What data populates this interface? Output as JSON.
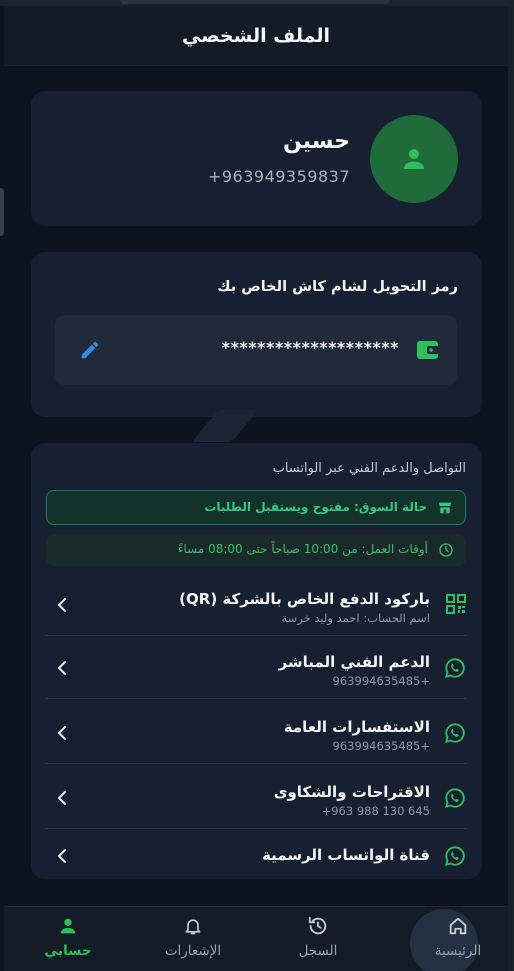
{
  "header": {
    "title": "الملف الشخصي"
  },
  "profile": {
    "name": "حسين",
    "phone": "+963949359837"
  },
  "transfer": {
    "title": "رمز التحويل لشام كاش الخاص بك",
    "masked_code": "********************"
  },
  "support": {
    "title": "التواصل والدعم الفني عبر الواتساب",
    "market_status": "حالة السوق: مفتوح ويستقبل الطلبات",
    "working_hours": "أوقات العمل: من 10:00 صباحاً حتى 08:00 مساءً",
    "items": [
      {
        "label": "باركود الدفع الخاص بالشركة (QR)",
        "sub": "اسم الحساب: احمد وليد خرسة",
        "icon": "qr-code-icon"
      },
      {
        "label": "الدعم الفني المباشر",
        "sub": "+963994635485",
        "icon": "whatsapp-icon"
      },
      {
        "label": "الاستفسارات العامة",
        "sub": "+963994635485",
        "icon": "whatsapp-icon"
      },
      {
        "label": "الاقتراحات والشكاوى",
        "sub": "+963 988 130 645",
        "icon": "whatsapp-icon"
      },
      {
        "label": "قناة الواتساب الرسمية",
        "sub": "",
        "icon": "whatsapp-icon"
      }
    ]
  },
  "nav": {
    "home": "الرئيسية",
    "history": "السجل",
    "notifications": "الإشعارات",
    "account": "حسابي"
  },
  "colors": {
    "background": "#0d1420",
    "card": "#172030",
    "accent_green": "#2fbf5c",
    "edit_blue": "#2f8ee8",
    "avatar_green": "#1f6b3a"
  }
}
